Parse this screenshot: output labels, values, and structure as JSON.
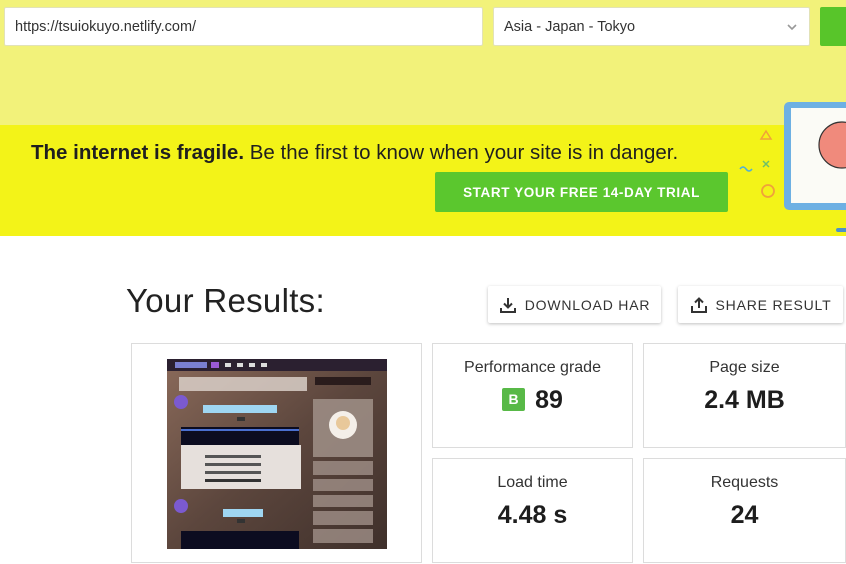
{
  "search": {
    "url_value": "https://tsuiokuyo.netlify.com/",
    "location_value": "Asia - Japan - Tokyo"
  },
  "banner": {
    "headline_bold": "The internet is fragile.",
    "headline_rest": " Be the first to know when your site is in danger.",
    "cta_label": "START YOUR FREE 14-DAY TRIAL"
  },
  "results": {
    "title": "Your Results:",
    "download_label": "DOWNLOAD HAR",
    "share_label": "SHARE RESULT"
  },
  "metrics": {
    "performance": {
      "label": "Performance grade",
      "grade": "B",
      "value": "89"
    },
    "page_size": {
      "label": "Page size",
      "value": "2.4 MB"
    },
    "load_time": {
      "label": "Load time",
      "value": "4.48 s"
    },
    "requests": {
      "label": "Requests",
      "value": "24"
    }
  },
  "colors": {
    "topbar": "#f2f27a",
    "banner": "#f3f318",
    "accent_green": "#5bc72e",
    "grade_b": "#58b947"
  },
  "icons": [
    "chevron-down-icon",
    "download-icon",
    "share-icon"
  ]
}
